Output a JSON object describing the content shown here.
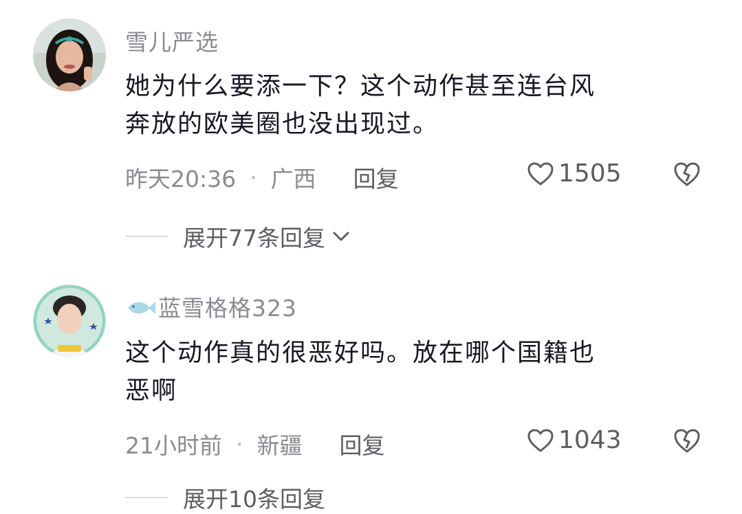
{
  "comments": [
    {
      "username": "雪儿严选",
      "text_line1": "她为什么要添一下？这个动作甚至连台风",
      "text_line2": "奔放的欧美圈也没出现过。",
      "time": "昨天20:36",
      "location": "广西",
      "reply_label": "回复",
      "likes": "1505",
      "expand_label": "展开77条回复"
    },
    {
      "username": "蓝雪格格323",
      "text_line1": "这个动作真的很恶好吗。放在哪个国籍也",
      "text_line2": "恶啊",
      "time": "21小时前",
      "location": "新疆",
      "reply_label": "回复",
      "likes": "1043",
      "expand_label": "展开10条回复"
    }
  ],
  "separator": "·",
  "colors": {
    "meta": "#8a8b91",
    "text": "#161823",
    "reply": "#5c5d63"
  },
  "icons": {
    "like": "heart-outline-icon",
    "dislike": "broken-heart-icon",
    "expand": "chevron-down-icon",
    "badge": "fish-icon"
  }
}
